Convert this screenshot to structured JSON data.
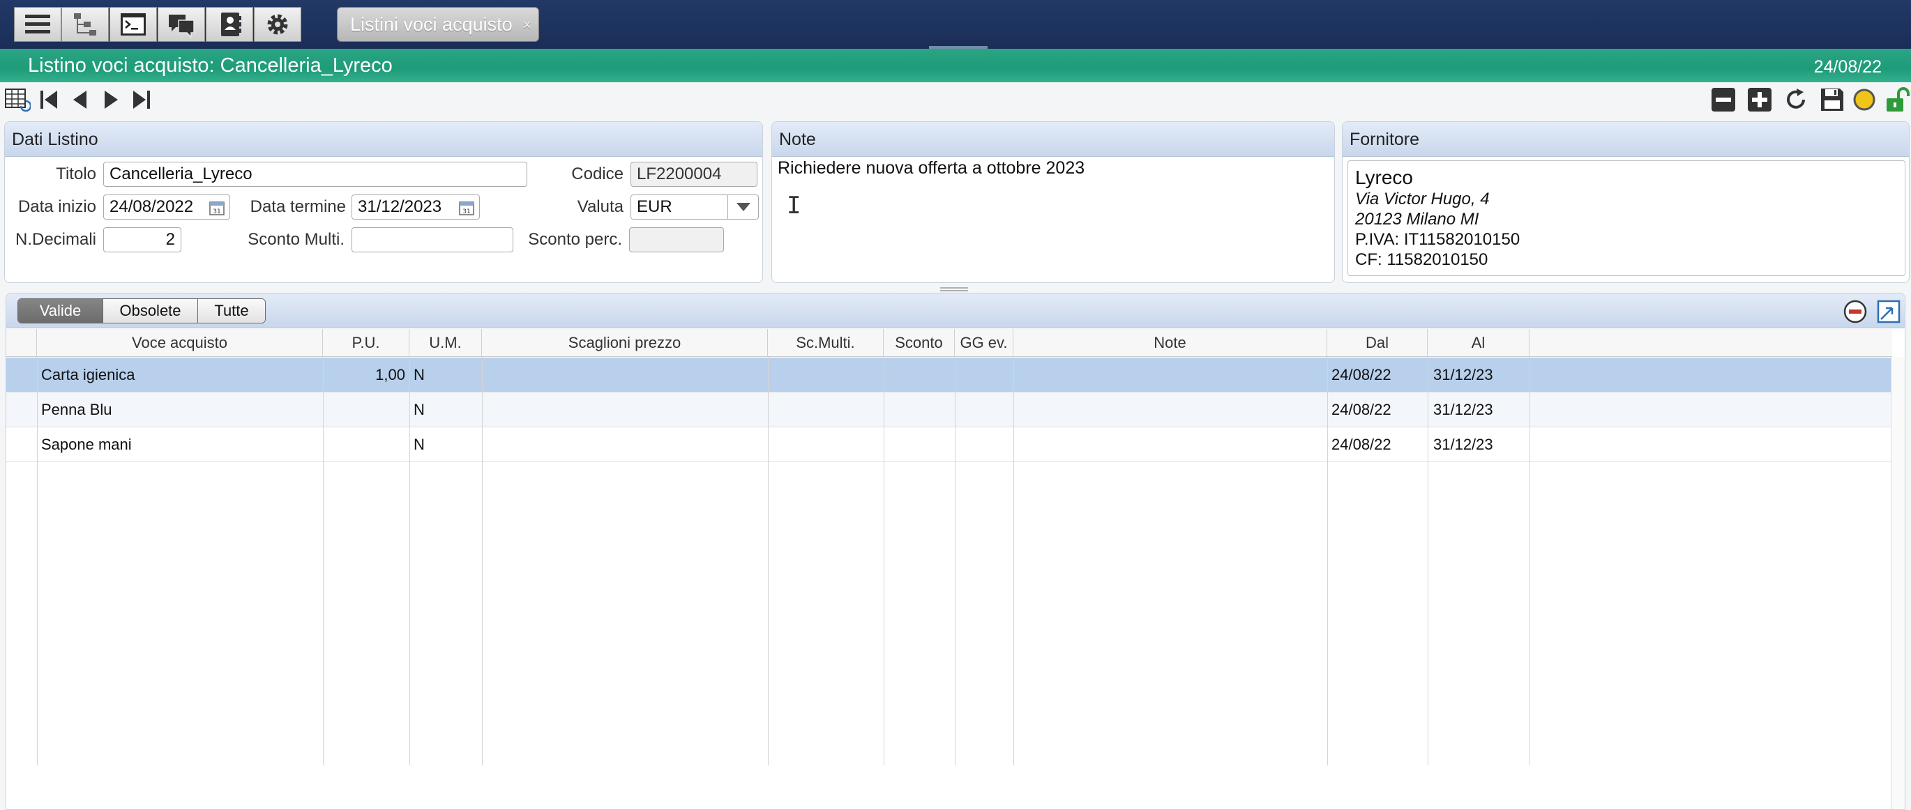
{
  "topbar": {
    "buttons": [
      "menu-icon",
      "tree-icon",
      "terminal-icon",
      "chat-icon",
      "contacts-icon",
      "gear-icon"
    ],
    "tab_label": "Listini voci acquisto",
    "tab_close": "×"
  },
  "titlebar": {
    "title": "Listino voci acquisto: Cancelleria_Lyreco",
    "date": "24/08/22"
  },
  "dati_listino": {
    "header": "Dati Listino",
    "titolo_label": "Titolo",
    "titolo_value": "Cancelleria_Lyreco",
    "codice_label": "Codice",
    "codice_value": "LF2200004",
    "data_inizio_label": "Data inizio",
    "data_inizio_value": "24/08/2022",
    "data_termine_label": "Data termine",
    "data_termine_value": "31/12/2023",
    "valuta_label": "Valuta",
    "valuta_value": "EUR",
    "ndecimali_label": "N.Decimali",
    "ndecimali_value": "2",
    "sconto_multi_label": "Sconto Multi.",
    "sconto_multi_value": "",
    "sconto_perc_label": "Sconto perc.",
    "sconto_perc_value": ""
  },
  "note": {
    "header": "Note",
    "text": "Richiedere nuova offerta a ottobre 2023"
  },
  "fornitore": {
    "header": "Fornitore",
    "name": "Lyreco",
    "address1": "Via Victor Hugo, 4",
    "address2": "20123 Milano  MI",
    "piva": "P.IVA: IT11582010150",
    "cf": "CF: 11582010150"
  },
  "filters": {
    "valide": "Valide",
    "obsolete": "Obsolete",
    "tutte": "Tutte",
    "active": "Valide"
  },
  "table": {
    "columns": [
      "Voce acquisto",
      "P.U.",
      "U.M.",
      "Scaglioni prezzo",
      "Sc.Multi.",
      "Sconto",
      "GG ev.",
      "Note",
      "Dal",
      "Al"
    ],
    "rows": [
      {
        "voce": "Carta igienica",
        "pu": "1,00",
        "um": "N",
        "scaglioni": "",
        "scmulti": "",
        "sconto": "",
        "ggev": "",
        "note": "",
        "dal": "24/08/22",
        "al": "31/12/23"
      },
      {
        "voce": "Penna Blu",
        "pu": "",
        "um": "N",
        "scaglioni": "",
        "scmulti": "",
        "sconto": "",
        "ggev": "",
        "note": "",
        "dal": "24/08/22",
        "al": "31/12/23"
      },
      {
        "voce": "Sapone mani",
        "pu": "",
        "um": "N",
        "scaglioni": "",
        "scmulti": "",
        "sconto": "",
        "ggev": "",
        "note": "",
        "dal": "24/08/22",
        "al": "31/12/23"
      }
    ]
  },
  "colors": {
    "topbar": "#1f3461",
    "titlebar": "#22a07f",
    "selected_row": "#b8d0ec"
  }
}
